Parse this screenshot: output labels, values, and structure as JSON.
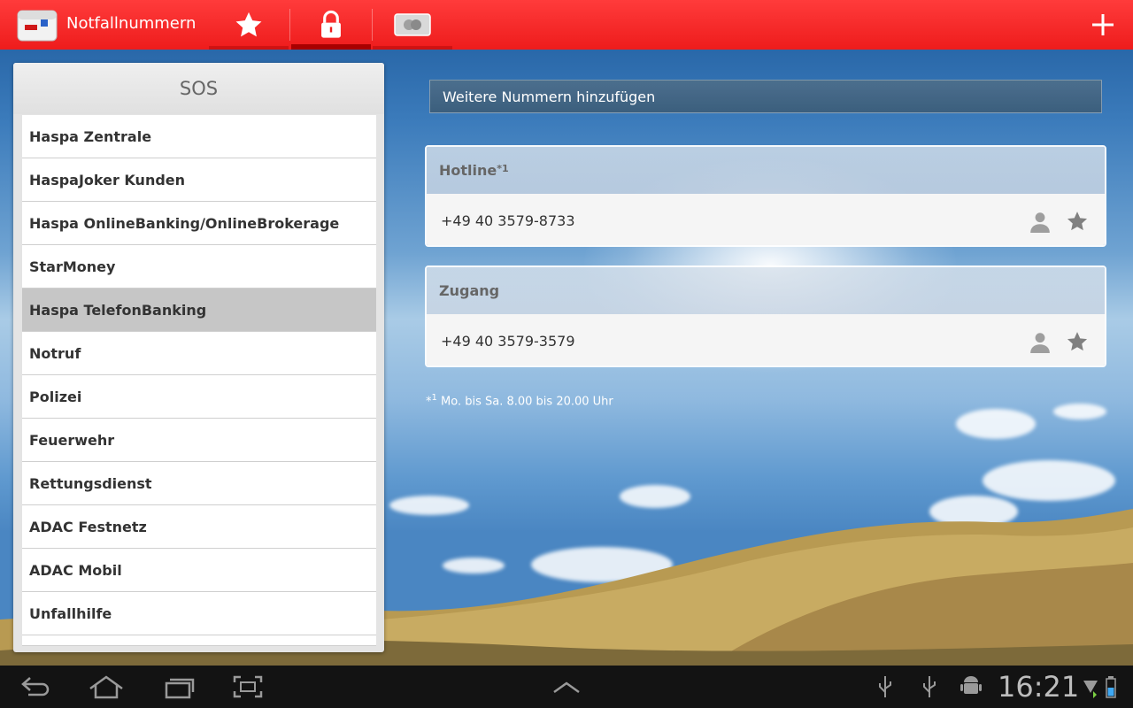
{
  "app": {
    "title": "Notfallnummern",
    "accent": "#ee1c1c",
    "tabs": [
      {
        "icon": "star-icon",
        "active": false
      },
      {
        "icon": "lock-icon",
        "active": true
      },
      {
        "icon": "card-icon",
        "active": false
      }
    ],
    "add_icon": "plus-icon"
  },
  "sidebar": {
    "title": "SOS",
    "items": [
      {
        "label": "Haspa Zentrale",
        "selected": false
      },
      {
        "label": "HaspaJoker Kunden",
        "selected": false
      },
      {
        "label": "Haspa OnlineBanking/OnlineBrokerage",
        "selected": false
      },
      {
        "label": "StarMoney",
        "selected": false
      },
      {
        "label": "Haspa TelefonBanking",
        "selected": true
      },
      {
        "label": "Notruf",
        "selected": false
      },
      {
        "label": "Polizei",
        "selected": false
      },
      {
        "label": "Feuerwehr",
        "selected": false
      },
      {
        "label": "Rettungsdienst",
        "selected": false
      },
      {
        "label": "ADAC Festnetz",
        "selected": false
      },
      {
        "label": "ADAC Mobil",
        "selected": false
      },
      {
        "label": "Unfallhilfe",
        "selected": false
      }
    ]
  },
  "main": {
    "add_more_label": "Weitere Nummern hinzufügen",
    "cards": [
      {
        "title": "Hotline",
        "title_sup": "*1",
        "number": "+49 40 3579-8733"
      },
      {
        "title": "Zugang",
        "title_sup": "",
        "number": "+49 40 3579-3579"
      }
    ],
    "footnote_mark": "*",
    "footnote_sup": "1",
    "footnote_text": "Mo. bis Sa. 8.00 bis 20.00 Uhr"
  },
  "system_bar": {
    "time": "16:21",
    "nav_icons": [
      "back-icon",
      "home-icon",
      "recent-apps-icon",
      "screenshot-icon"
    ],
    "status_icons": [
      "usb-icon",
      "usb-icon",
      "android-debug-icon",
      "wifi-icon",
      "battery-icon"
    ]
  }
}
